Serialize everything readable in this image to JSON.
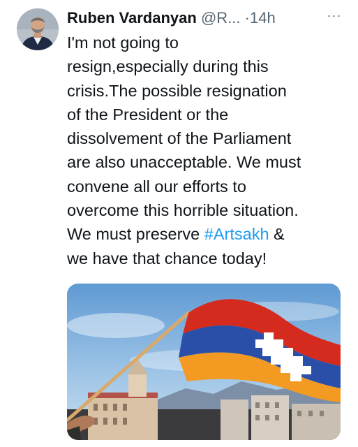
{
  "tweet": {
    "author": {
      "display_name": "Ruben Vardanyan",
      "handle": "@R...",
      "separator": "·",
      "time": "14h"
    },
    "more_label": "···",
    "text_lines": {
      "l1": "I'm not going to",
      "l2": "resign,especially during this",
      "l3": "crisis.The possible resignation",
      "l4": "of the President or the",
      "l5": "dissolvement of the Parliament",
      "l6": "are also unacceptable. We must",
      "l7": "convene all our efforts to",
      "l8": "overcome this horrible situation.",
      "l9_before": "We must preserve ",
      "hashtag": "#Artsakh",
      "l9_after": " &",
      "l10": "we have that chance today!"
    },
    "colors": {
      "text": "#0f1419",
      "secondary": "#536471",
      "link": "#1d9bf0",
      "flag_red": "#d52b1e",
      "flag_blue": "#2a4fa8",
      "flag_orange": "#f29a22"
    },
    "media_description_icon": "photo-waving-flag"
  }
}
